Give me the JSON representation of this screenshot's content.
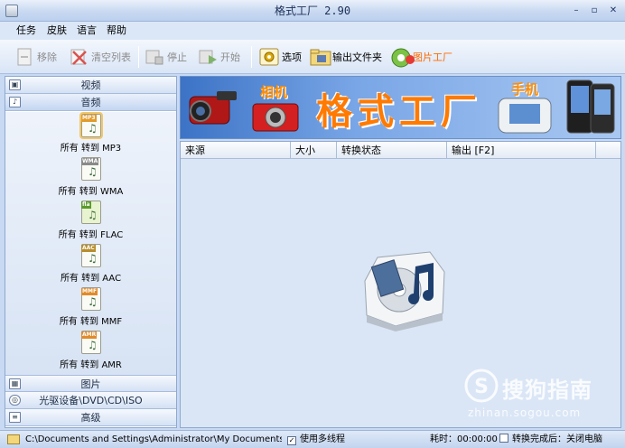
{
  "window": {
    "title": "格式工厂  2.90",
    "min_label": "–",
    "max_label": "▫",
    "close_label": "✕"
  },
  "menu": [
    "任务",
    "皮肤",
    "语言",
    "帮助"
  ],
  "toolbar": {
    "remove": "移除",
    "clear_list": "清空列表",
    "stop": "停止",
    "start": "开始",
    "options": "选项",
    "output_folder": "输出文件夹",
    "picture_factory": "图片工厂"
  },
  "sidebar": {
    "categories": {
      "video": "视频",
      "audio": "音频",
      "picture": "图片",
      "rom": "光驱设备\\DVD\\CD\\ISO",
      "advanced": "高级"
    },
    "conversions": [
      {
        "badge": "MP3",
        "label": "所有 转到 MP3"
      },
      {
        "badge": "WMA",
        "label": "所有 转到 WMA"
      },
      {
        "badge": "fla",
        "label": "所有 转到 FLAC"
      },
      {
        "badge": "AAC",
        "label": "所有 转到 AAC"
      },
      {
        "badge": "MMF",
        "label": "所有 转到 MMF"
      },
      {
        "badge": "AMR",
        "label": "所有 转到 AMR"
      }
    ]
  },
  "banner": {
    "camera": "相机",
    "main": "格式工厂",
    "phone": "手机"
  },
  "table": {
    "columns": [
      "来源",
      "大小",
      "转换状态",
      "输出 [F2]"
    ]
  },
  "statusbar": {
    "output_path": "C:\\Documents and Settings\\Administrator\\My Documents\\FFOutput",
    "multithread_label": "使用多线程",
    "multithread_checked": true,
    "elapsed": "耗时：00:00:00",
    "shutdown_label": "转换完成后：关闭电脑",
    "shutdown_checked": false
  },
  "watermark": {
    "brand": "搜狗指南",
    "url": "zhinan.sogou.com"
  },
  "colors": {
    "accent": "#ff7a00",
    "panel": "#dae6f6",
    "banner": "#3c73c6"
  }
}
